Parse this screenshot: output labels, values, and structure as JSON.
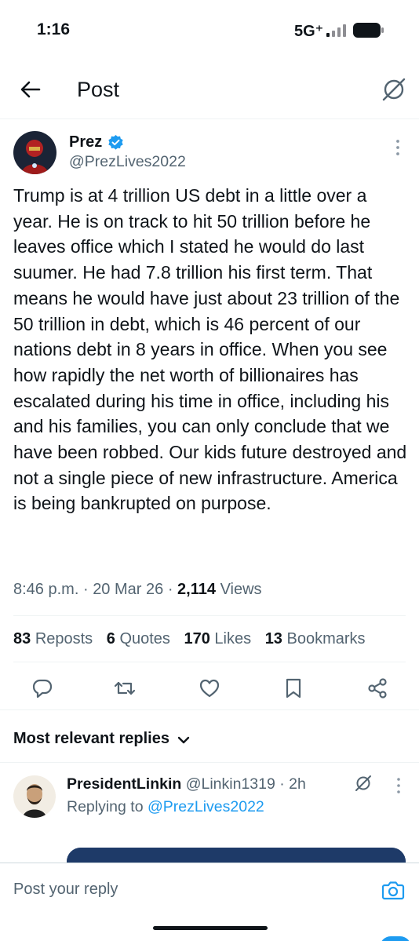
{
  "status_bar": {
    "time": "1:16",
    "network": "5G⁺"
  },
  "header": {
    "title": "Post",
    "back_icon": "arrow-left-icon",
    "grok_icon": "grok-icon"
  },
  "tweet": {
    "author_name": "Prez",
    "author_handle": "@PrezLives2022",
    "verified": true,
    "text": "Trump is at 4 trillion US debt in a little over a year. He is on track to hit 50 trillion before he leaves office which I stated he would do last suumer. He had 7.8 trillion his first term. That means he would have just about 23 trillion of the 50 trillion in debt, which is 46 percent of our nations debt in 8 years in office. When you see how rapidly the net worth of billionaires has escalated during his time in office, including his and his families, you can only conclude that we have been robbed. Our kids future destroyed and not a single piece of new infrastructure. America is being bankrupted on purpose.",
    "time": "8:46 p.m.",
    "date": "20 Mar 26",
    "views_count": "2,114",
    "views_label": "Views",
    "separator": "·"
  },
  "stats": [
    {
      "count": "83",
      "label": "Reposts"
    },
    {
      "count": "6",
      "label": "Quotes"
    },
    {
      "count": "170",
      "label": "Likes"
    },
    {
      "count": "13",
      "label": "Bookmarks"
    }
  ],
  "actions": [
    "reply-icon",
    "repost-icon",
    "like-icon",
    "bookmark-icon",
    "share-icon"
  ],
  "replies": {
    "sort_label": "Most relevant replies",
    "items": [
      {
        "name": "PresidentLinkin",
        "handle": "@Linkin1319",
        "time": "· 2h",
        "replying_prefix": "Replying to",
        "replying_to": "@PrezLives2022"
      }
    ]
  },
  "composer": {
    "placeholder": "Post your reply",
    "camera_icon": "camera-icon"
  },
  "colors": {
    "accent": "#1d9bf0",
    "secondary_text": "#536471",
    "primary_text": "#0f1419"
  }
}
